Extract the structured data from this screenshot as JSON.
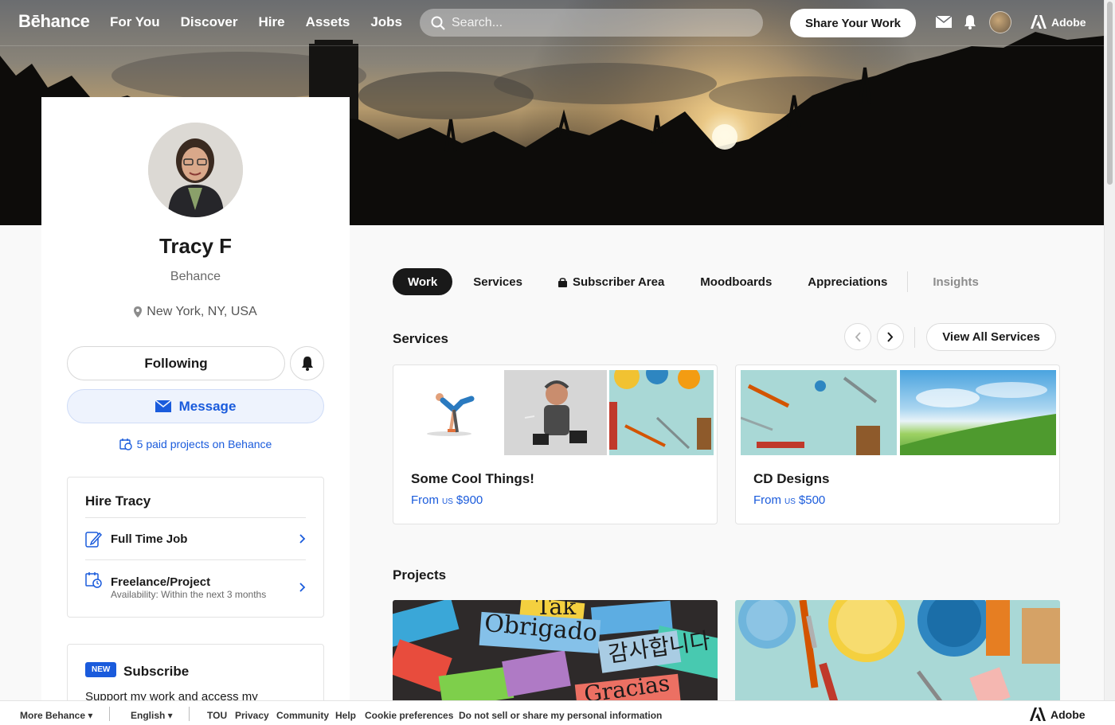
{
  "nav": {
    "logo": "Bēhance",
    "links": [
      "For You",
      "Discover",
      "Hire",
      "Assets",
      "Jobs"
    ],
    "search_placeholder": "Search...",
    "share_label": "Share Your Work",
    "adobe_label": "Adobe"
  },
  "profile": {
    "name": "Tracy F",
    "org": "Behance",
    "location": "New York, NY, USA",
    "following_label": "Following",
    "message_label": "Message",
    "paid_projects": "5 paid projects on Behance"
  },
  "hire": {
    "title": "Hire Tracy",
    "options": [
      {
        "label": "Full Time Job",
        "sub": ""
      },
      {
        "label": "Freelance/Project",
        "sub": "Availability: Within the next 3 months"
      }
    ]
  },
  "subscribe": {
    "badge": "NEW",
    "title": "Subscribe",
    "text": "Support my work and access my"
  },
  "tabs": [
    "Work",
    "Services",
    "Subscriber Area",
    "Moodboards",
    "Appreciations",
    "Insights"
  ],
  "services_section": {
    "title": "Services",
    "view_all": "View All Services",
    "cards": [
      {
        "title": "Some Cool Things!",
        "from": "From",
        "currency": "US",
        "price": "$900"
      },
      {
        "title": "CD Designs",
        "from": "From",
        "currency": "US",
        "price": "$500"
      }
    ]
  },
  "projects_section": {
    "title": "Projects",
    "words": [
      "Obrigado",
      "Gracias",
      "Tak",
      "감사합니다"
    ]
  },
  "footer": {
    "more": "More Behance",
    "language": "English",
    "links": [
      "TOU",
      "Privacy",
      "Community",
      "Help",
      "Cookie preferences",
      "Do not sell or share my personal information"
    ],
    "adobe": "Adobe"
  }
}
